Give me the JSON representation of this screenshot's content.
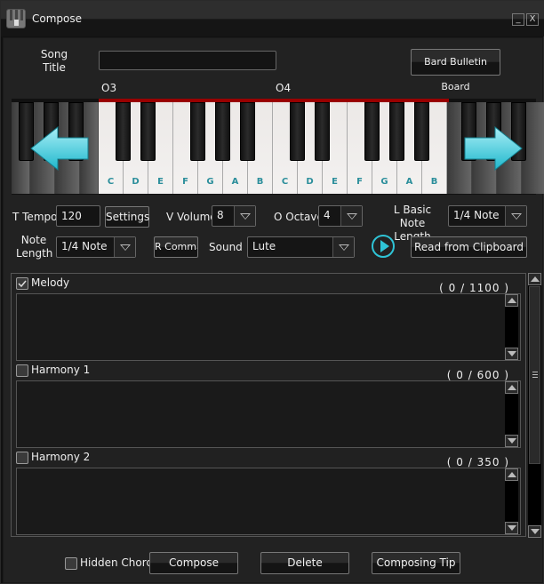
{
  "window": {
    "title": "Compose",
    "minimize_label": "_",
    "close_label": "X"
  },
  "header": {
    "song_title_label": "Song\nTitle",
    "song_title_value": "",
    "bulletin_button": "Bard Bulletin Board"
  },
  "piano": {
    "octave_labels": [
      "O3",
      "O4"
    ],
    "white_keys": [
      "C",
      "D",
      "E",
      "F",
      "G",
      "A",
      "B",
      "C",
      "D",
      "E",
      "F",
      "G",
      "A",
      "B"
    ],
    "left_arrow": "arrow-left-icon",
    "right_arrow": "arrow-right-icon",
    "accent_color": "#2fc4d6"
  },
  "controls": {
    "tempo_label": "T Tempo",
    "tempo_value": "120",
    "settings_button": "Settings",
    "volume_label": "V Volume",
    "volume_value": "8",
    "octave_label": "O Octave",
    "octave_value": "4",
    "basic_len_label": "L Basic Note Length",
    "basic_len_value": "1/4 Note",
    "note_len_label": "Note Length",
    "note_len_value": "1/4 Note",
    "comma_button": "R Comma",
    "sound_label": "Sound",
    "sound_value": "Lute",
    "play_icon": "play-icon",
    "clipboard_button": "Read from Clipboard"
  },
  "tracks": [
    {
      "name": "Melody",
      "checked": true,
      "count": "( 0 / 1100 )",
      "text": ""
    },
    {
      "name": "Harmony 1",
      "checked": false,
      "count": "( 0 / 600 )",
      "text": ""
    },
    {
      "name": "Harmony 2",
      "checked": false,
      "count": "( 0 / 350 )",
      "text": ""
    }
  ],
  "footer": {
    "hidden_chords_label": "Hidden Chords",
    "compose_button": "Compose",
    "delete_button": "Delete",
    "tip_button": "Composing Tip"
  }
}
